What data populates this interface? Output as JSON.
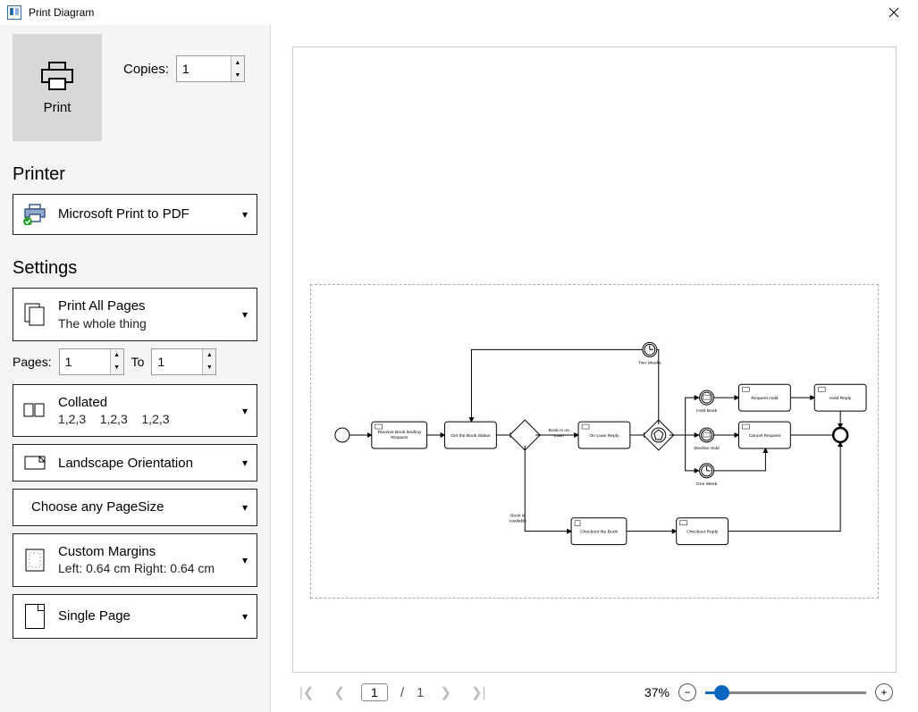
{
  "window": {
    "title": "Print Diagram"
  },
  "print_button": {
    "label": "Print"
  },
  "copies": {
    "label": "Copies:",
    "value": "1"
  },
  "sections": {
    "printer": "Printer",
    "settings": "Settings"
  },
  "printer": {
    "name": "Microsoft Print to PDF"
  },
  "print_range": {
    "title": "Print All Pages",
    "sub": "The whole thing"
  },
  "pages_row": {
    "pages_label": "Pages:",
    "from": "1",
    "to_label": "To",
    "to": "1"
  },
  "collate": {
    "title": "Collated",
    "sub": "1,2,3    1,2,3    1,2,3"
  },
  "orientation": {
    "title": "Landscape Orientation"
  },
  "pagesize": {
    "title": "Choose any PageSize"
  },
  "margins": {
    "title": "Custom Margins",
    "sub": "Left: 0.64 cm Right: 0.64 cm"
  },
  "singlepage": {
    "title": "Single Page"
  },
  "nav": {
    "current": "1",
    "sep": "/",
    "total": "1"
  },
  "zoom": {
    "percent": "37%",
    "value": 10
  },
  "diagram": {
    "t_twoweeks": "Two Weeks",
    "t_holdbook": "Hold Book",
    "t_declinehold": "Decline Hold",
    "t_oneweek": "One Week",
    "t_bookonloan": "Book is on\nLoan",
    "t_bookavail": "Book is\nAvailable",
    "n_receive": "Receive Book lending\nRequest",
    "n_getstatus": "Get the Book Status",
    "n_onloanreply": "On Loan Reply",
    "n_requesthold": "Request Hold",
    "n_holdreply": "Hold Reply",
    "n_cancelreq": "Cancel Request",
    "n_checkoutbook": "Checkout the Book",
    "n_checkoutreply": "Checkout Reply"
  }
}
